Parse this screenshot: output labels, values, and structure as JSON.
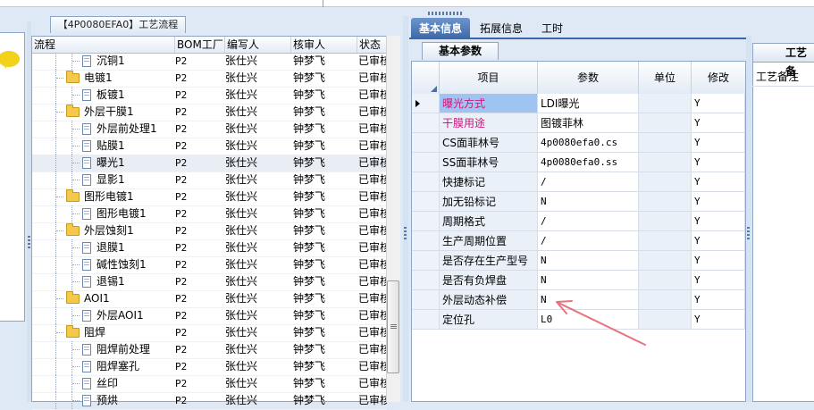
{
  "window": {
    "route_tab_title": "【4P0080EFA0】工艺流程"
  },
  "tree": {
    "headers": [
      "流程",
      "BOM工厂",
      "编写人",
      "核审人",
      "状态"
    ],
    "rows": [
      {
        "name": "沉铜1",
        "bom": "P2",
        "writer": "张仕兴",
        "reviewer": "钟梦飞",
        "status": "已审核"
      },
      {
        "name": "电镀1",
        "bom": "P2",
        "writer": "张仕兴",
        "reviewer": "钟梦飞",
        "status": "已审核"
      },
      {
        "name": "板镀1",
        "bom": "P2",
        "writer": "张仕兴",
        "reviewer": "钟梦飞",
        "status": "已审核"
      },
      {
        "name": "外层干膜1",
        "bom": "P2",
        "writer": "张仕兴",
        "reviewer": "钟梦飞",
        "status": "已审核"
      },
      {
        "name": "外层前处理1",
        "bom": "P2",
        "writer": "张仕兴",
        "reviewer": "钟梦飞",
        "status": "已审核"
      },
      {
        "name": "贴膜1",
        "bom": "P2",
        "writer": "张仕兴",
        "reviewer": "钟梦飞",
        "status": "已审核"
      },
      {
        "name": "曝光1",
        "bom": "P2",
        "writer": "张仕兴",
        "reviewer": "钟梦飞",
        "status": "已审核"
      },
      {
        "name": "显影1",
        "bom": "P2",
        "writer": "张仕兴",
        "reviewer": "钟梦飞",
        "status": "已审核"
      },
      {
        "name": "图形电镀1",
        "bom": "P2",
        "writer": "张仕兴",
        "reviewer": "钟梦飞",
        "status": "已审核"
      },
      {
        "name": "图形电镀1",
        "bom": "P2",
        "writer": "张仕兴",
        "reviewer": "钟梦飞",
        "status": "已审核"
      },
      {
        "name": "外层蚀刻1",
        "bom": "P2",
        "writer": "张仕兴",
        "reviewer": "钟梦飞",
        "status": "已审核"
      },
      {
        "name": "退膜1",
        "bom": "P2",
        "writer": "张仕兴",
        "reviewer": "钟梦飞",
        "status": "已审核"
      },
      {
        "name": "碱性蚀刻1",
        "bom": "P2",
        "writer": "张仕兴",
        "reviewer": "钟梦飞",
        "status": "已审核"
      },
      {
        "name": "退锡1",
        "bom": "P2",
        "writer": "张仕兴",
        "reviewer": "钟梦飞",
        "status": "已审核"
      },
      {
        "name": "AOI1",
        "bom": "P2",
        "writer": "张仕兴",
        "reviewer": "钟梦飞",
        "status": "已审核"
      },
      {
        "name": "外层AOI1",
        "bom": "P2",
        "writer": "张仕兴",
        "reviewer": "钟梦飞",
        "status": "已审核"
      },
      {
        "name": "阻焊",
        "bom": "P2",
        "writer": "张仕兴",
        "reviewer": "钟梦飞",
        "status": "已审核"
      },
      {
        "name": "阻焊前处理",
        "bom": "P2",
        "writer": "张仕兴",
        "reviewer": "钟梦飞",
        "status": "已审核"
      },
      {
        "name": "阻焊塞孔",
        "bom": "P2",
        "writer": "张仕兴",
        "reviewer": "钟梦飞",
        "status": "已审核"
      },
      {
        "name": "丝印",
        "bom": "P2",
        "writer": "张仕兴",
        "reviewer": "钟梦飞",
        "status": "已审核"
      },
      {
        "name": "预烘",
        "bom": "P2",
        "writer": "张仕兴",
        "reviewer": "钟梦飞",
        "status": "已审核"
      }
    ]
  },
  "tabs": {
    "basic": "基本信息",
    "extended": "拓展信息",
    "hours": "工时"
  },
  "subtab": "基本参数",
  "params": {
    "headers": [
      "项目",
      "参数",
      "单位",
      "修改"
    ],
    "rows": [
      {
        "item": "曝光方式",
        "value": "LDI曝光",
        "unit": "",
        "modify": "Y"
      },
      {
        "item": "干膜用途",
        "value": "图镀菲林",
        "unit": "",
        "modify": "Y"
      },
      {
        "item": "CS面菲林号",
        "value": "4p0080efa0.cs",
        "unit": "",
        "modify": "Y"
      },
      {
        "item": "SS面菲林号",
        "value": "4p0080efa0.ss",
        "unit": "",
        "modify": "Y"
      },
      {
        "item": "快捷标记",
        "value": "/",
        "unit": "",
        "modify": "Y"
      },
      {
        "item": "加无铅标记",
        "value": "N",
        "unit": "",
        "modify": "Y"
      },
      {
        "item": "周期格式",
        "value": "/",
        "unit": "",
        "modify": "Y"
      },
      {
        "item": "生产周期位置",
        "value": "/",
        "unit": "",
        "modify": "Y"
      },
      {
        "item": "是否存在生产型号",
        "value": "N",
        "unit": "",
        "modify": "Y"
      },
      {
        "item": "是否有负焊盘",
        "value": "N",
        "unit": "",
        "modify": "Y"
      },
      {
        "item": "外层动态补偿",
        "value": "N",
        "unit": "",
        "modify": "Y"
      },
      {
        "item": "定位孔",
        "value": "L0",
        "unit": "",
        "modify": "Y"
      }
    ]
  },
  "right_panel": {
    "title": "工艺备",
    "label": "工艺备注"
  },
  "colors": {
    "accent": "#3a67a8",
    "highlight": "#9fc4f2",
    "pink_text": "#d0167a",
    "arrow": "#e8737f",
    "folder": "#f4c84a"
  }
}
